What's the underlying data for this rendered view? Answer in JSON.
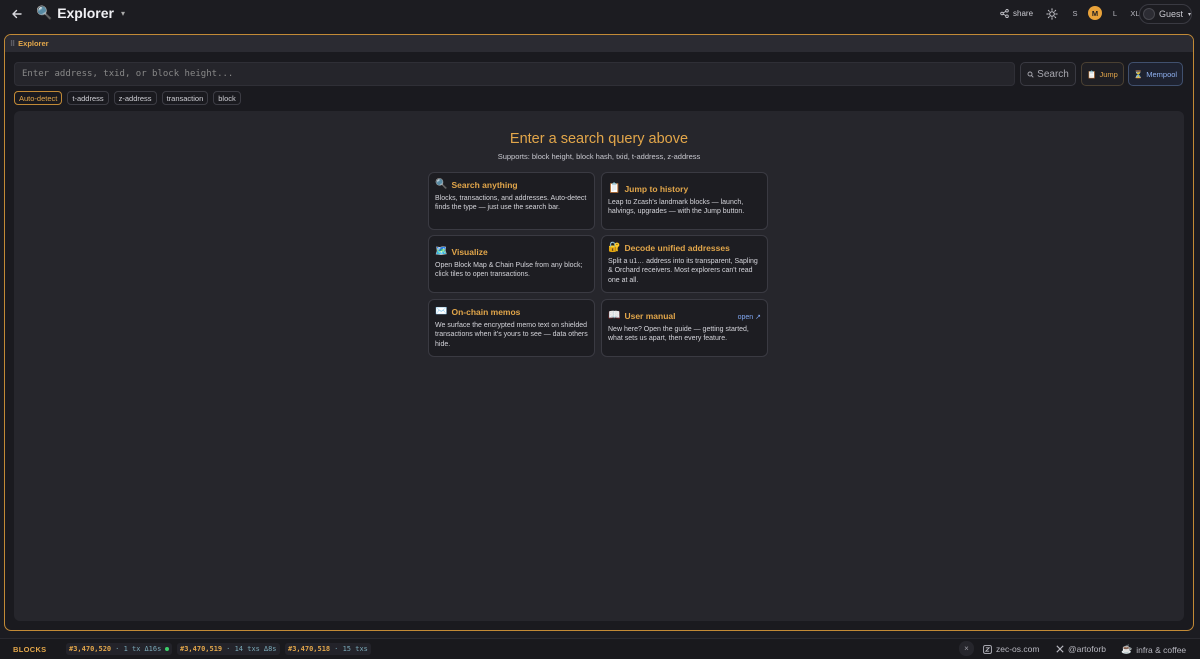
{
  "topbar": {
    "title": "Explorer",
    "share_label": "share",
    "sizes": [
      "S",
      "M",
      "L",
      "XL"
    ],
    "active_size": "M",
    "user_label": "Guest"
  },
  "window": {
    "title": "Explorer",
    "search_placeholder": "Enter address, txid, or block height...",
    "search_label": "Search",
    "jump_label": "Jump",
    "mempool_label": "Mempool",
    "filters": [
      "Auto-detect",
      "t-address",
      "z-address",
      "transaction",
      "block"
    ],
    "active_filter": "Auto-detect"
  },
  "hero": {
    "title": "Enter a search query above",
    "subtitle": "Supports: block height, block hash, txid, t-address, z-address"
  },
  "cards": [
    {
      "icon": "🔍",
      "title": "Search anything",
      "body": "Blocks, transactions, and addresses. Auto-detect finds the type — just use the search bar."
    },
    {
      "icon": "📋",
      "title": "Jump to history",
      "body": "Leap to Zcash's landmark blocks — launch, halvings, upgrades — with the Jump button."
    },
    {
      "icon": "🗺️",
      "title": "Visualize",
      "body": "Open Block Map & Chain Pulse from any block; click tiles to open transactions."
    },
    {
      "icon": "🔐",
      "title": "Decode unified addresses",
      "body": "Split a u1… address into its transparent, Sapling & Orchard receivers. Most explorers can't read one at all."
    },
    {
      "icon": "✉️",
      "title": "On-chain memos",
      "body": "We surface the encrypted memo text on shielded transactions when it's yours to see — data others hide."
    },
    {
      "icon": "📖",
      "title": "User manual",
      "body": "New here? Open the guide — getting started, what sets us apart, then every feature.",
      "link": "open ↗"
    }
  ],
  "bottombar": {
    "blocks_label": "BLOCKS",
    "blocks": [
      {
        "height": "#3,470,520",
        "txs": "· 1 tx",
        "age": "Δ16s",
        "live": true
      },
      {
        "height": "#3,470,519",
        "txs": "· 14 txs",
        "age": "Δ8s",
        "live": false
      },
      {
        "height": "#3,470,518",
        "txs": "· 15 txs",
        "age": "",
        "live": false
      }
    ],
    "close_label": "×",
    "links": [
      "zec-os.com",
      "@artoforb",
      "infra & coffee"
    ]
  },
  "colors": {
    "accent": "#e2a64a",
    "border_accent": "#c28a36",
    "mempool": "#8fb0f0",
    "live": "#3ccf6a"
  }
}
